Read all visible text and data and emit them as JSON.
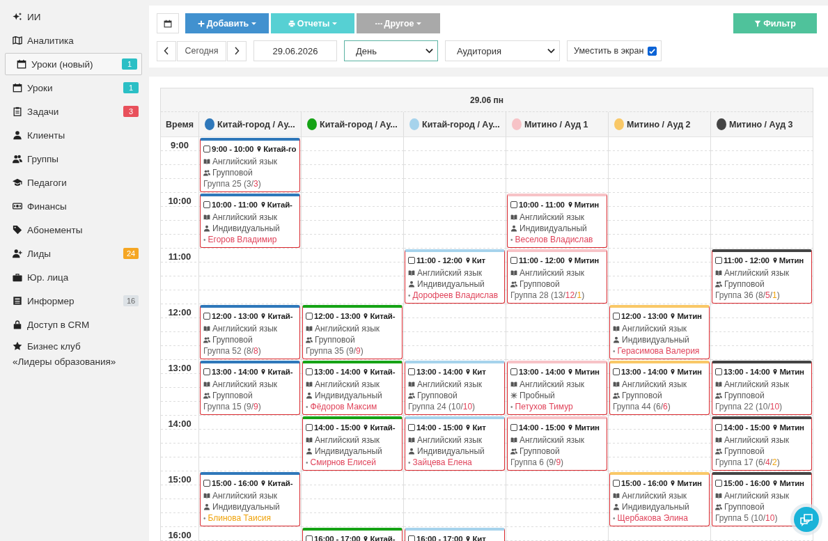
{
  "sidebar": {
    "items": [
      {
        "label": "ИИ",
        "selected": false
      },
      {
        "label": "Аналитика",
        "selected": false
      },
      {
        "label": "Уроки (новый)",
        "selected": true,
        "badge": {
          "text": "1",
          "color": "#2bbfc5"
        }
      },
      {
        "label": "Уроки",
        "selected": false,
        "badge": {
          "text": "1",
          "color": "#2bbfc5"
        }
      },
      {
        "label": "Задачи",
        "selected": false,
        "badge": {
          "text": "3",
          "color": "#e8505b"
        }
      },
      {
        "label": "Клиенты",
        "selected": false
      },
      {
        "label": "Группы",
        "selected": false
      },
      {
        "label": "Педагоги",
        "selected": false
      },
      {
        "label": "Финансы",
        "selected": false
      },
      {
        "label": "Абонементы",
        "selected": false
      },
      {
        "label": "Лиды",
        "selected": false,
        "badge": {
          "text": "24",
          "color": "#f5a623"
        }
      },
      {
        "label": "Юр. лица",
        "selected": false
      },
      {
        "label": "Информер",
        "selected": false,
        "badge": {
          "text": "16",
          "color": "#dde2e6"
        }
      },
      {
        "label": "Доступ в CRM",
        "selected": false
      },
      {
        "label": "Бизнес клуб\n«Лидеры образования»",
        "selected": false
      }
    ]
  },
  "toolbar": {
    "buttons": [
      {
        "label": "Добавить",
        "kind": "add",
        "disabled": false
      },
      {
        "label": "Отчеты",
        "kind": "reports",
        "disabled": false
      },
      {
        "label": "Другое",
        "kind": "other",
        "disabled": true
      }
    ],
    "filter": {
      "label": "Фильтр"
    },
    "today": "Сегодня",
    "date": "29.06.2026",
    "view_select": "День",
    "resource_select": "Аудитория",
    "fit": {
      "label": "Уместить в экран",
      "checked": true
    }
  },
  "calendar": {
    "date_header": "29.06 пн",
    "time_header": "Время",
    "columns": [
      {
        "name": "Китай-город / Ау...",
        "color": "#2f78ba"
      },
      {
        "name": "Китай-город / Ау...",
        "color": "#16a316"
      },
      {
        "name": "Китай-город / Ау...",
        "color": "#a6d3ec"
      },
      {
        "name": "Митино / Ауд 1",
        "color": "#f7c3c7"
      },
      {
        "name": "Митино / Ауд 2",
        "color": "#f9c867"
      },
      {
        "name": "Митино / Ауд 3",
        "color": "#444444"
      }
    ],
    "rows": [
      {
        "time": "9:00",
        "cells": [
          {
            "kind": "lesson",
            "checked": false,
            "time": "9:00 - 10:00",
            "place": "Китай-го",
            "subject": "Английский язык",
            "format": {
              "kind": "group",
              "label": "Групповой"
            },
            "group": [
              {
                "text": "Группа 25 (3/",
                "kind": "plain"
              },
              {
                "text": "3",
                "kind": "full"
              },
              {
                "text": ")",
                "kind": "plain"
              }
            ]
          },
          {
            "kind": "empty"
          },
          {
            "kind": "empty"
          },
          {
            "kind": "empty"
          },
          {
            "kind": "empty"
          },
          {
            "kind": "empty"
          }
        ]
      },
      {
        "time": "10:00",
        "cells": [
          {
            "kind": "lesson",
            "checked": false,
            "time": "10:00 - 11:00",
            "place": "Китай-",
            "subject": "Английский язык",
            "format": {
              "kind": "individual",
              "label": "Индивидуальный"
            },
            "student": {
              "bullet": "•",
              "name": "Егоров Владимир",
              "color": "#e0435a"
            }
          },
          {
            "kind": "empty"
          },
          {
            "kind": "empty"
          },
          {
            "kind": "lesson",
            "checked": false,
            "time": "10:00 - 11:00",
            "place": "Митин",
            "subject": "Английский язык",
            "format": {
              "kind": "individual",
              "label": "Индивидуальный"
            },
            "student": {
              "bullet": "•",
              "name": "Веселов Владислав",
              "color": "#e0435a"
            }
          },
          {
            "kind": "empty"
          },
          {
            "kind": "empty"
          }
        ]
      },
      {
        "time": "11:00",
        "cells": [
          {
            "kind": "empty"
          },
          {
            "kind": "empty"
          },
          {
            "kind": "lesson",
            "checked": false,
            "time": "11:00 - 12:00",
            "place": "Кит",
            "subject": "Английский язык",
            "format": {
              "kind": "individual",
              "label": "Индивидуальный"
            },
            "student": {
              "bullet": "•",
              "name": "Дорофеев Владислав",
              "color": "#e0435a"
            }
          },
          {
            "kind": "lesson",
            "checked": false,
            "time": "11:00 - 12:00",
            "place": "Митин",
            "subject": "Английский язык",
            "format": {
              "kind": "group",
              "label": "Групповой"
            },
            "group": [
              {
                "text": "Группа 28 (13/",
                "kind": "plain"
              },
              {
                "text": "12",
                "kind": "full"
              },
              {
                "text": "/",
                "kind": "plain"
              },
              {
                "text": "1",
                "kind": "extra"
              },
              {
                "text": ")",
                "kind": "plain"
              }
            ]
          },
          {
            "kind": "empty"
          },
          {
            "kind": "lesson",
            "checked": false,
            "time": "11:00 - 12:00",
            "place": "Митин",
            "subject": "Английский язык",
            "format": {
              "kind": "group",
              "label": "Групповой"
            },
            "group": [
              {
                "text": "Группа 36 (8/",
                "kind": "plain"
              },
              {
                "text": "5",
                "kind": "full"
              },
              {
                "text": "/",
                "kind": "plain"
              },
              {
                "text": "1",
                "kind": "extra"
              },
              {
                "text": ")",
                "kind": "plain"
              }
            ]
          }
        ]
      },
      {
        "time": "12:00",
        "cells": [
          {
            "kind": "lesson",
            "checked": false,
            "time": "12:00 - 13:00",
            "place": "Китай-",
            "subject": "Английский язык",
            "format": {
              "kind": "group",
              "label": "Групповой"
            },
            "group": [
              {
                "text": "Группа 52 (8/",
                "kind": "plain"
              },
              {
                "text": "8",
                "kind": "full"
              },
              {
                "text": ")",
                "kind": "plain"
              }
            ]
          },
          {
            "kind": "lesson",
            "checked": false,
            "time": "12:00 - 13:00",
            "place": "Китай-",
            "subject": "Английский язык",
            "format": {
              "kind": "group",
              "label": "Групповой"
            },
            "group": [
              {
                "text": "Группа 35 (9/",
                "kind": "plain"
              },
              {
                "text": "9",
                "kind": "full"
              },
              {
                "text": ")",
                "kind": "plain"
              }
            ]
          },
          {
            "kind": "empty"
          },
          {
            "kind": "empty"
          },
          {
            "kind": "lesson",
            "checked": false,
            "time": "12:00 - 13:00",
            "place": "Митин",
            "subject": "Английский язык",
            "format": {
              "kind": "individual",
              "label": "Индивидуальный"
            },
            "student": {
              "bullet": "•",
              "name": "Герасимова Валерия",
              "color": "#e0435a"
            }
          },
          {
            "kind": "empty"
          }
        ]
      },
      {
        "time": "13:00",
        "cells": [
          {
            "kind": "lesson",
            "checked": false,
            "time": "13:00 - 14:00",
            "place": "Китай-",
            "subject": "Английский язык",
            "format": {
              "kind": "group",
              "label": "Групповой"
            },
            "group": [
              {
                "text": "Группа 15 (9/",
                "kind": "plain"
              },
              {
                "text": "9",
                "kind": "full"
              },
              {
                "text": ")",
                "kind": "plain"
              }
            ]
          },
          {
            "kind": "lesson",
            "checked": false,
            "time": "13:00 - 14:00",
            "place": "Китай-",
            "subject": "Английский язык",
            "format": {
              "kind": "individual",
              "label": "Индивидуальный"
            },
            "student": {
              "bullet": "•",
              "name": "Фёдоров Максим",
              "color": "#e0435a"
            }
          },
          {
            "kind": "lesson",
            "checked": false,
            "time": "13:00 - 14:00",
            "place": "Кит",
            "subject": "Английский язык",
            "format": {
              "kind": "group",
              "label": "Групповой"
            },
            "group": [
              {
                "text": "Группа 24 (10/",
                "kind": "plain"
              },
              {
                "text": "10",
                "kind": "full"
              },
              {
                "text": ")",
                "kind": "plain"
              }
            ]
          },
          {
            "kind": "lesson",
            "checked": false,
            "time": "13:00 - 14:00",
            "place": "Митин",
            "subject": "Английский язык",
            "format": {
              "kind": "trial",
              "label": "Пробный"
            },
            "student": {
              "bullet": "•",
              "name": "Петухов Тимур",
              "color": "#e0435a"
            }
          },
          {
            "kind": "lesson",
            "checked": false,
            "time": "13:00 - 14:00",
            "place": "Митин",
            "subject": "Английский язык",
            "format": {
              "kind": "group",
              "label": "Групповой"
            },
            "group": [
              {
                "text": "Группа 44 (6/",
                "kind": "plain"
              },
              {
                "text": "6",
                "kind": "full"
              },
              {
                "text": ")",
                "kind": "plain"
              }
            ]
          },
          {
            "kind": "lesson",
            "checked": false,
            "time": "13:00 - 14:00",
            "place": "Митин",
            "subject": "Английский язык",
            "format": {
              "kind": "group",
              "label": "Групповой"
            },
            "group": [
              {
                "text": "Группа 22 (10/",
                "kind": "plain"
              },
              {
                "text": "10",
                "kind": "full"
              },
              {
                "text": ")",
                "kind": "plain"
              }
            ]
          }
        ]
      },
      {
        "time": "14:00",
        "cells": [
          {
            "kind": "empty"
          },
          {
            "kind": "lesson",
            "checked": false,
            "time": "14:00 - 15:00",
            "place": "Китай-",
            "subject": "Английский язык",
            "format": {
              "kind": "individual",
              "label": "Индивидуальный"
            },
            "student": {
              "bullet": "•",
              "name": "Смирнов Елисей",
              "color": "#e0435a"
            }
          },
          {
            "kind": "lesson",
            "checked": false,
            "time": "14:00 - 15:00",
            "place": "Кит",
            "subject": "Английский язык",
            "format": {
              "kind": "individual",
              "label": "Индивидуальный"
            },
            "student": {
              "bullet": "•",
              "name": "Зайцева Елена",
              "color": "#e0435a"
            }
          },
          {
            "kind": "lesson",
            "checked": false,
            "time": "14:00 - 15:00",
            "place": "Митин",
            "subject": "Английский язык",
            "format": {
              "kind": "group",
              "label": "Групповой"
            },
            "group": [
              {
                "text": "Группа 6 (9/",
                "kind": "plain"
              },
              {
                "text": "9",
                "kind": "full"
              },
              {
                "text": ")",
                "kind": "plain"
              }
            ]
          },
          {
            "kind": "empty"
          },
          {
            "kind": "lesson",
            "checked": false,
            "time": "14:00 - 15:00",
            "place": "Митин",
            "subject": "Английский язык",
            "format": {
              "kind": "group",
              "label": "Групповой"
            },
            "group": [
              {
                "text": "Группа 17 (6/",
                "kind": "plain"
              },
              {
                "text": "4",
                "kind": "full"
              },
              {
                "text": "/",
                "kind": "plain"
              },
              {
                "text": "2",
                "kind": "extra"
              },
              {
                "text": ")",
                "kind": "plain"
              }
            ]
          }
        ]
      },
      {
        "time": "15:00",
        "cells": [
          {
            "kind": "lesson",
            "checked": false,
            "time": "15:00 - 16:00",
            "place": "Китай-",
            "subject": "Английский язык",
            "format": {
              "kind": "individual",
              "label": "Индивидуальный"
            },
            "student": {
              "bullet": "•",
              "name": "Блинова Таисия",
              "color": "#f0a30a"
            }
          },
          {
            "kind": "empty"
          },
          {
            "kind": "empty"
          },
          {
            "kind": "empty"
          },
          {
            "kind": "lesson",
            "checked": false,
            "time": "15:00 - 16:00",
            "place": "Митин",
            "subject": "Английский язык",
            "format": {
              "kind": "individual",
              "label": "Индивидуальный"
            },
            "student": {
              "bullet": "•",
              "name": "Щербакова Элина",
              "color": "#e0435a"
            }
          },
          {
            "kind": "lesson",
            "checked": false,
            "time": "15:00 - 16:00",
            "place": "Митин",
            "subject": "Английский язык",
            "format": {
              "kind": "group",
              "label": "Групповой"
            },
            "group": [
              {
                "text": "Группа 5 (10/",
                "kind": "plain"
              },
              {
                "text": "10",
                "kind": "full"
              },
              {
                "text": ")",
                "kind": "plain"
              }
            ]
          }
        ]
      },
      {
        "time": "16:00",
        "cells": [
          {
            "kind": "empty"
          },
          {
            "kind": "lesson",
            "checked": false,
            "time": "16:00 - 17:00",
            "place": "Китай-"
          },
          {
            "kind": "lesson",
            "checked": false,
            "time": "16:00 - 17:00",
            "place": "Кит"
          },
          {
            "kind": "empty"
          },
          {
            "kind": "empty"
          },
          {
            "kind": "empty"
          }
        ]
      }
    ]
  }
}
